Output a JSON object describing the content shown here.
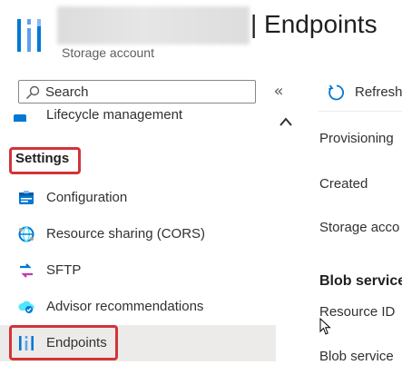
{
  "header": {
    "title": "| Endpoints",
    "subtitle": "Storage account"
  },
  "search": {
    "placeholder": "Search",
    "collapse_icon": "«"
  },
  "sidebar": {
    "partial_item": {
      "label": "Lifecycle management",
      "icon": "lifecycle-icon"
    },
    "section_heading": "Settings",
    "items": [
      {
        "label": "Configuration",
        "icon": "configuration-icon"
      },
      {
        "label": "Resource sharing (CORS)",
        "icon": "cors-icon"
      },
      {
        "label": "SFTP",
        "icon": "sftp-icon"
      },
      {
        "label": "Advisor recommendations",
        "icon": "advisor-icon"
      },
      {
        "label": "Endpoints",
        "icon": "endpoints-icon",
        "selected": true
      }
    ],
    "highlight_color": "#d13438"
  },
  "toolbar": {
    "refresh_label": "Refresh",
    "refresh_icon": "refresh-icon"
  },
  "properties": {
    "provisioning": "Provisioning",
    "created": "Created",
    "storage_account": "Storage acco",
    "section_blob": "Blob service",
    "resource_id": "Resource ID",
    "blob_service": "Blob service"
  },
  "colors": {
    "accent": "#0078d4",
    "selected_bg": "#edebe9",
    "highlight": "#d13438"
  }
}
